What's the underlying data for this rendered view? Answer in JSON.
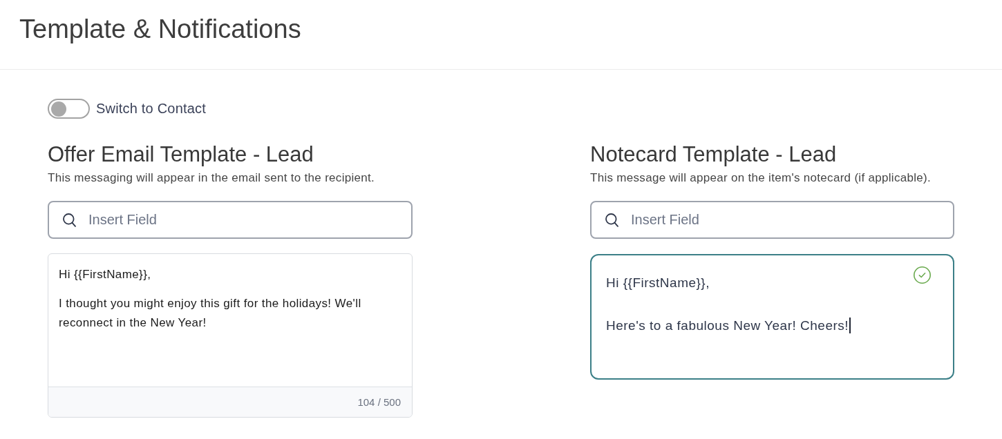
{
  "page": {
    "title": "Template & Notifications"
  },
  "contact_switch": {
    "label": "Switch to Contact",
    "on": false
  },
  "templates": [
    {
      "kind": "email",
      "heading": "Offer Email Template - Lead",
      "description": "This messaging will appear in the email sent to the recipient.",
      "search": {
        "placeholder": "Insert Field"
      },
      "focused": false,
      "paragraphs": [
        "Hi {{FirstName}},",
        "I thought you might enjoy this gift for the holidays! We'll reconnect in the New Year!"
      ],
      "counter": "104 / 500"
    },
    {
      "kind": "notecard",
      "heading": "Notecard Template - Lead",
      "description": "This message will appear on the item's notecard (if applicable).",
      "search": {
        "placeholder": "Insert Field"
      },
      "focused": true,
      "validated": true,
      "paragraphs": [
        "Hi {{FirstName}},",
        "Here's to a fabulous New Year! Cheers!"
      ]
    }
  ]
}
